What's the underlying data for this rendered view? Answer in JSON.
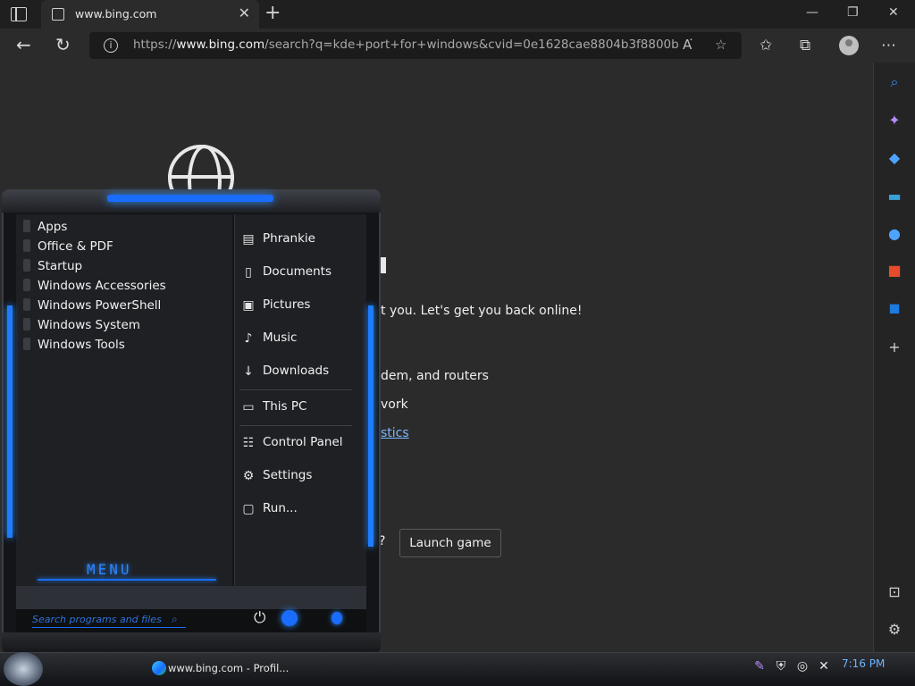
{
  "browser": {
    "tab_title": "www.bing.com",
    "url_host": "www.bing.com",
    "url_prefix": "https://",
    "url_path": "/search?q=kde+port+for+windows&cvid=0e1628cae8804b3f8800be50a6..."
  },
  "page": {
    "line1": "t you. Let's get you back online!",
    "line2": "dem, and routers",
    "line3": "vork",
    "line4": "stics",
    "line5": "?",
    "launch_button": "Launch game"
  },
  "start_menu": {
    "apps": [
      "Apps",
      "Office & PDF",
      "Startup",
      "Windows Accessories",
      "Windows PowerShell",
      "Windows System",
      "Windows Tools"
    ],
    "places": [
      "Phrankie",
      "Documents",
      "Pictures",
      "Music",
      "Downloads",
      "This PC",
      "Control Panel",
      "Settings",
      "Run..."
    ],
    "menu_label": "MENU",
    "search_placeholder": "Search programs and files"
  },
  "taskbar": {
    "app_label": "www.bing.com - Profil...",
    "clock": "7:16 PM"
  },
  "icons": {
    "sidebar": [
      "search-icon",
      "copilot-icon",
      "tag-icon",
      "toolbox-icon",
      "people-icon",
      "office-icon",
      "outlook-icon",
      "add-icon",
      "split-screen-icon",
      "gear-icon"
    ]
  },
  "colors": {
    "accent_blue": "#1a6cff",
    "link": "#7ab7ff",
    "background": "#2b2b2b"
  }
}
